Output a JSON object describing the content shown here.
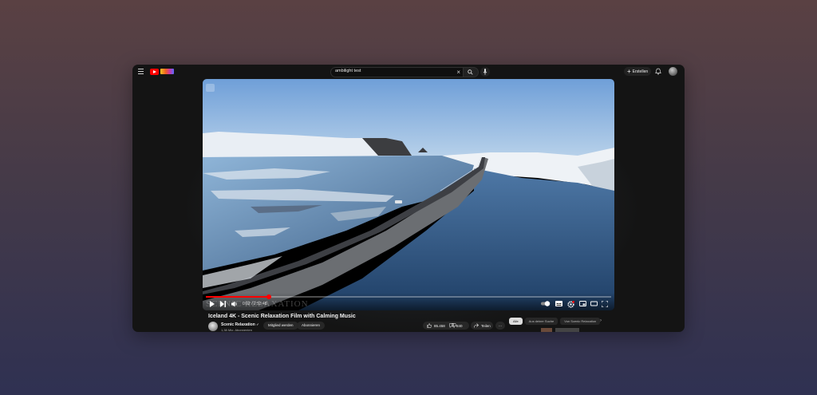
{
  "colors": {
    "accent": "#ff0000",
    "background_top": "#5a4143",
    "background_bottom": "#2f3152",
    "window": "#141414"
  },
  "topbar": {
    "menu_icon": "hamburger-icon",
    "logo_icon": "youtube-logo-icon",
    "search": {
      "value": "ambilight test",
      "clear_icon": "close-icon",
      "search_icon": "search-icon"
    },
    "mic_icon": "mic-icon",
    "create_label": "Erstellen",
    "bell_icon": "bell-icon"
  },
  "player": {
    "watermark": "SCENIC RELAXATION",
    "time": "0:02 / 2:53:48",
    "progress": 0.155,
    "autoplay_state": "on"
  },
  "video_info": {
    "title": "Iceland 4K - Scenic Relaxation Film with Calming Music",
    "channel_name": "Scenic Relaxation",
    "channel_verified_icon": "verified-icon",
    "subscribers": "1,38 Mio. Abonnenten",
    "join_label": "Mitglied werden",
    "subscribe_label": "Abonnieren",
    "likes": "85.458",
    "comments": "840",
    "share_label": "Teilen",
    "more_label": "···"
  },
  "recommendations": {
    "chips": [
      "Alle",
      "Aus deiner Suche",
      "Von Scenic Relaxation"
    ],
    "next_icon": "chevron-right-icon"
  }
}
